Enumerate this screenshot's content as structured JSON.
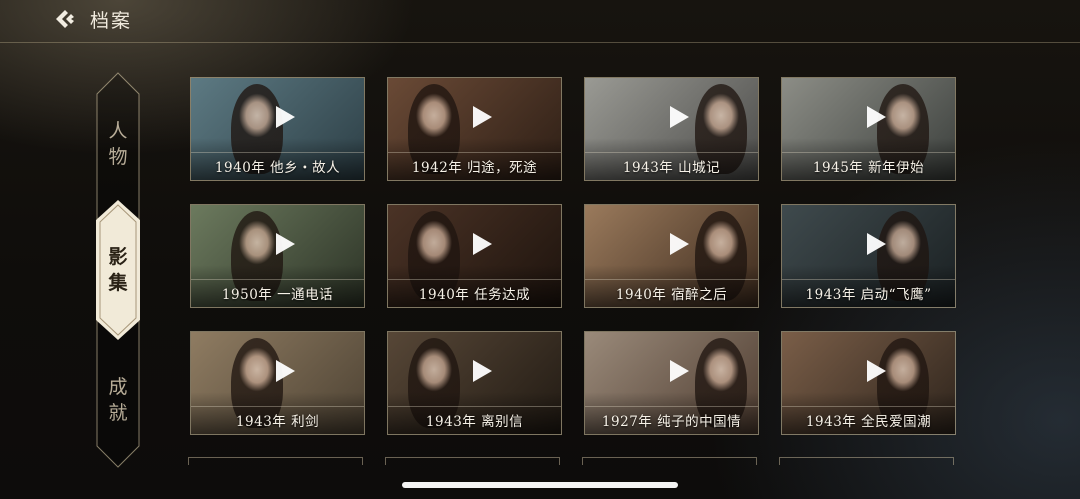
{
  "header": {
    "title": "档案"
  },
  "sidebar": {
    "items": [
      {
        "label_top": "人",
        "label_bottom": "物"
      },
      {
        "label_top": "影",
        "label_bottom": "集"
      },
      {
        "label_top": "成",
        "label_bottom": "就"
      }
    ],
    "active_index": 1
  },
  "gallery": {
    "cards": [
      {
        "year": "1940年",
        "title": "他乡・故人",
        "colors": [
          "#5d7a83",
          "#2c3e45"
        ]
      },
      {
        "year": "1942年",
        "title": "归途，死途",
        "colors": [
          "#6a4a36",
          "#2d1e15"
        ]
      },
      {
        "year": "1943年",
        "title": "山城记",
        "colors": [
          "#9a9a94",
          "#4a4a48"
        ]
      },
      {
        "year": "1945年",
        "title": "新年伊始",
        "colors": [
          "#8c8d86",
          "#3b3f3c"
        ]
      },
      {
        "year": "1950年",
        "title": "一通电话",
        "colors": [
          "#6c7a5e",
          "#2c3326"
        ]
      },
      {
        "year": "1940年",
        "title": "任务达成",
        "colors": [
          "#4b3326",
          "#1d130d"
        ]
      },
      {
        "year": "1940年",
        "title": "宿醉之后",
        "colors": [
          "#9a7a5c",
          "#3c2a1d"
        ]
      },
      {
        "year": "1943年",
        "title": "启动“飞鹰”",
        "colors": [
          "#3f4a4d",
          "#1a2022"
        ]
      },
      {
        "year": "1943年",
        "title": "利剑",
        "colors": [
          "#8f7c62",
          "#4d4233"
        ]
      },
      {
        "year": "1943年",
        "title": "离别信",
        "colors": [
          "#574737",
          "#211a13"
        ]
      },
      {
        "year": "1927年",
        "title": "纯子的中国情",
        "colors": [
          "#9a8a7a",
          "#4e3c30"
        ]
      },
      {
        "year": "1943年",
        "title": "全民爱国潮",
        "colors": [
          "#7a5e48",
          "#2e241c"
        ]
      }
    ]
  },
  "colors": {
    "accent_gold": "#d9c9a3",
    "active_tab_bg": "#f1ead8",
    "background": "#121010"
  }
}
